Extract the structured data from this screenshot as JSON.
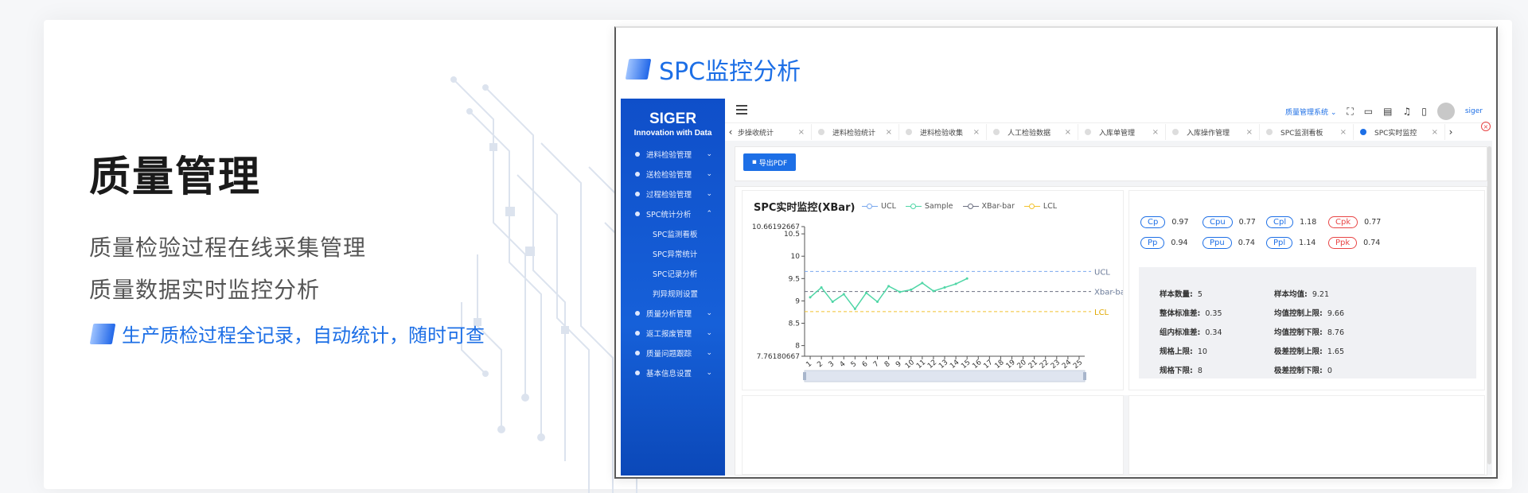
{
  "hero": {
    "title": "质量管理",
    "line1": "质量检验过程在线采集管理",
    "line2": "质量数据实时监控分析",
    "highlight": "生产质检过程全记录，自动统计，随时可查"
  },
  "screenshot": {
    "title": "SPC监控分析",
    "logo_main": "SIGER",
    "logo_sub": "Innovation with Data",
    "menu": [
      {
        "label": "进料检验管理",
        "chev": "⌄"
      },
      {
        "label": "送检检验管理",
        "chev": "⌄"
      },
      {
        "label": "过程检验管理",
        "chev": "⌄"
      },
      {
        "label": "SPC统计分析",
        "chev": "⌃"
      }
    ],
    "submenu": [
      "SPC监测看板",
      "SPC异常统计",
      "SPC记录分析",
      "判异规则设置"
    ],
    "menu2": [
      {
        "label": "质量分析管理",
        "chev": "⌄"
      },
      {
        "label": "返工报废管理",
        "chev": "⌄"
      },
      {
        "label": "质量问题跟踪",
        "chev": "⌄"
      },
      {
        "label": "基本信息设置",
        "chev": "⌄"
      }
    ],
    "topbar": {
      "system": "质量管理系统 ⌄",
      "user": "siger"
    },
    "tabs": [
      {
        "label": "步操收统计",
        "close": "×"
      },
      {
        "label": "进料检验统计",
        "close": "×"
      },
      {
        "label": "进料检验收集",
        "close": "×"
      },
      {
        "label": "人工检验数据",
        "close": "×"
      },
      {
        "label": "入库单管理",
        "close": "×"
      },
      {
        "label": "入库操作管理",
        "close": "×"
      },
      {
        "label": "SPC监测看板",
        "close": "×"
      },
      {
        "label": "SPC实时监控",
        "close": "×"
      }
    ],
    "export_label": "导出PDF",
    "chart_title": "SPC实时监控(XBar)",
    "legend": [
      {
        "name": "UCL",
        "color": "#7aa8ee"
      },
      {
        "name": "Sample",
        "color": "#4fd6a6"
      },
      {
        "name": "XBar-bar",
        "color": "#6b6f80"
      },
      {
        "name": "LCL",
        "color": "#f2c22e"
      }
    ],
    "indices_row1": [
      {
        "name": "Cp",
        "value": "0.97",
        "alert": false
      },
      {
        "name": "Cpu",
        "value": "0.77",
        "alert": false
      },
      {
        "name": "Cpl",
        "value": "1.18",
        "alert": false
      },
      {
        "name": "Cpk",
        "value": "0.77",
        "alert": true
      }
    ],
    "indices_row2": [
      {
        "name": "Pp",
        "value": "0.94",
        "alert": false
      },
      {
        "name": "Ppu",
        "value": "0.74",
        "alert": false
      },
      {
        "name": "Ppl",
        "value": "1.14",
        "alert": false
      },
      {
        "name": "Ppk",
        "value": "0.74",
        "alert": true
      }
    ],
    "stats_left": [
      {
        "k": "样本数量:",
        "v": "5"
      },
      {
        "k": "整体标准差:",
        "v": "0.35"
      },
      {
        "k": "组内标准差:",
        "v": "0.34"
      },
      {
        "k": "规格上限:",
        "v": "10"
      },
      {
        "k": "规格下限:",
        "v": "8"
      }
    ],
    "stats_right": [
      {
        "k": "样本均值:",
        "v": "9.21"
      },
      {
        "k": "均值控制上限:",
        "v": "9.66"
      },
      {
        "k": "均值控制下限:",
        "v": "8.76"
      },
      {
        "k": "极差控制上限:",
        "v": "1.65"
      },
      {
        "k": "极差控制下限:",
        "v": "0"
      }
    ]
  },
  "chart_data": {
    "type": "line",
    "title": "SPC实时监控(XBar)",
    "x": [
      1,
      2,
      3,
      4,
      5,
      6,
      7,
      8,
      9,
      10,
      11,
      12,
      13,
      14,
      15,
      16,
      17,
      18,
      19,
      20,
      21,
      22,
      23,
      24,
      25
    ],
    "ylim": [
      7.76180667,
      10.66192667
    ],
    "yticks": [
      "10.66192667",
      "10.5",
      "10",
      "9.5",
      "9",
      "8.5",
      "8",
      "7.76180667"
    ],
    "series": [
      {
        "name": "Sample",
        "color": "#4fd6a6",
        "values": [
          9.08,
          9.3,
          8.98,
          9.15,
          8.82,
          9.18,
          8.98,
          9.33,
          9.2,
          9.25,
          9.4,
          9.22,
          9.3,
          9.38,
          9.5
        ]
      },
      {
        "name": "UCL",
        "color": "#7aa8ee",
        "constant": 9.66
      },
      {
        "name": "XBar-bar",
        "color": "#6b6f80",
        "constant": 9.21
      },
      {
        "name": "LCL",
        "color": "#f2c22e",
        "constant": 8.76
      }
    ],
    "line_labels": [
      {
        "series": "UCL",
        "text": "UCL"
      },
      {
        "series": "XBar-bar",
        "text": "Xbar-bar"
      },
      {
        "series": "LCL",
        "text": "LCL"
      }
    ]
  }
}
